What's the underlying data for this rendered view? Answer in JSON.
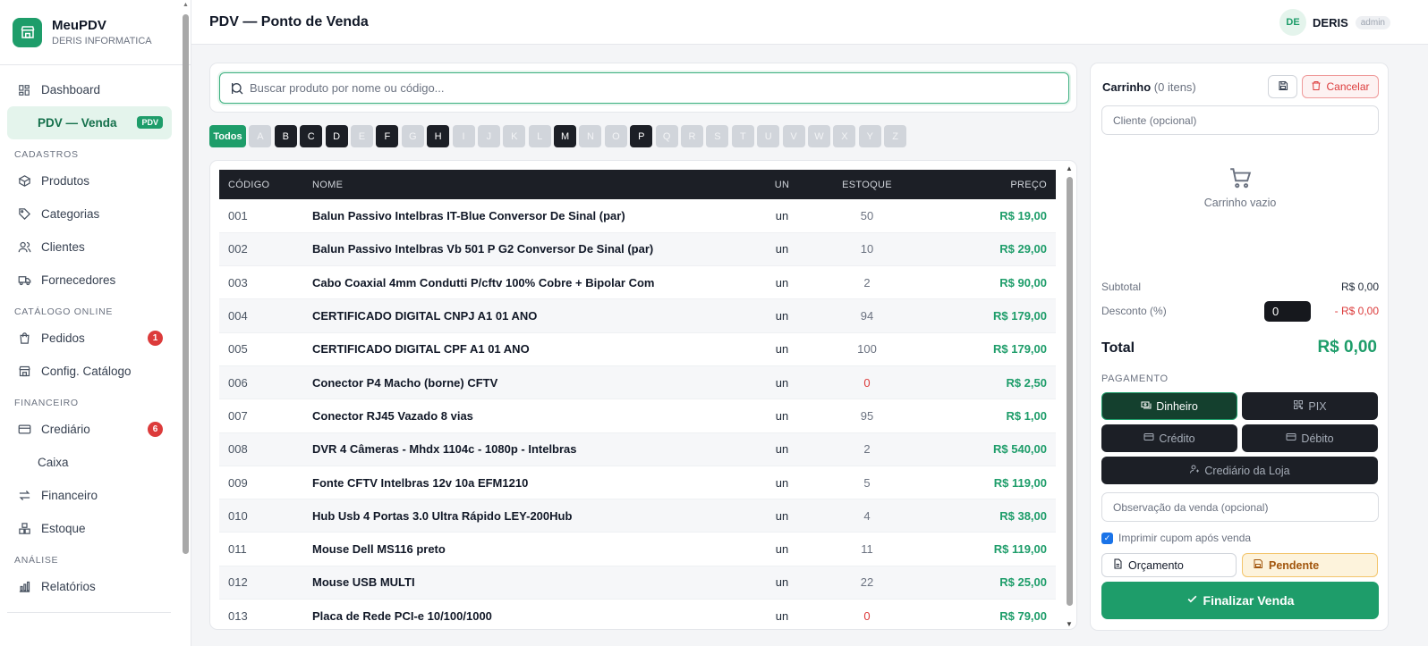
{
  "brand": {
    "name": "MeuPDV",
    "subtitle": "DERIS INFORMATICA",
    "logo_icon": "store-icon"
  },
  "nav": {
    "dashboard": "Dashboard",
    "pdv": "PDV — Venda",
    "pdv_badge": "PDV",
    "sec_cadastros": "CADASTROS",
    "produtos": "Produtos",
    "categorias": "Categorias",
    "clientes": "Clientes",
    "fornecedores": "Fornecedores",
    "sec_catalogo": "CATÁLOGO ONLINE",
    "pedidos": "Pedidos",
    "pedidos_count": "1",
    "config_catalogo": "Config. Catálogo",
    "sec_financeiro": "FINANCEIRO",
    "crediario": "Crediário",
    "crediario_count": "6",
    "caixa": "Caixa",
    "financeiro": "Financeiro",
    "estoque": "Estoque",
    "sec_analise": "ANÁLISE",
    "relatorios": "Relatórios"
  },
  "header": {
    "title": "PDV — Ponto de Venda",
    "user_initials": "DE",
    "user_name": "DERIS",
    "user_role": "admin"
  },
  "search": {
    "placeholder": "Buscar produto por nome ou código..."
  },
  "letter_filter": {
    "all_label": "Todos",
    "letters": [
      {
        "l": "A",
        "on": false
      },
      {
        "l": "B",
        "on": true
      },
      {
        "l": "C",
        "on": true
      },
      {
        "l": "D",
        "on": true
      },
      {
        "l": "E",
        "on": false
      },
      {
        "l": "F",
        "on": true
      },
      {
        "l": "G",
        "on": false
      },
      {
        "l": "H",
        "on": true
      },
      {
        "l": "I",
        "on": false
      },
      {
        "l": "J",
        "on": false
      },
      {
        "l": "K",
        "on": false
      },
      {
        "l": "L",
        "on": false
      },
      {
        "l": "M",
        "on": true
      },
      {
        "l": "N",
        "on": false
      },
      {
        "l": "O",
        "on": false
      },
      {
        "l": "P",
        "on": true
      },
      {
        "l": "Q",
        "on": false
      },
      {
        "l": "R",
        "on": false
      },
      {
        "l": "S",
        "on": false
      },
      {
        "l": "T",
        "on": false
      },
      {
        "l": "U",
        "on": false
      },
      {
        "l": "V",
        "on": false
      },
      {
        "l": "W",
        "on": false
      },
      {
        "l": "X",
        "on": false
      },
      {
        "l": "Y",
        "on": false
      },
      {
        "l": "Z",
        "on": false
      }
    ]
  },
  "table": {
    "headers": {
      "code": "CÓDIGO",
      "name": "NOME",
      "un": "UN",
      "stock": "ESTOQUE",
      "price": "PREÇO"
    },
    "rows": [
      {
        "code": "001",
        "name": "Balun Passivo Intelbras IT-Blue Conversor De Sinal (par)",
        "un": "un",
        "stock": "50",
        "price": "R$ 19,00"
      },
      {
        "code": "002",
        "name": "Balun Passivo Intelbras Vb 501 P G2 Conversor De Sinal (par)",
        "un": "un",
        "stock": "10",
        "price": "R$ 29,00"
      },
      {
        "code": "003",
        "name": "Cabo Coaxial 4mm Condutti P/cftv 100% Cobre + Bipolar Com",
        "un": "un",
        "stock": "2",
        "price": "R$ 90,00"
      },
      {
        "code": "004",
        "name": "CERTIFICADO DIGITAL CNPJ A1 01 ANO",
        "un": "un",
        "stock": "94",
        "price": "R$ 179,00"
      },
      {
        "code": "005",
        "name": "CERTIFICADO DIGITAL CPF A1 01 ANO",
        "un": "un",
        "stock": "100",
        "price": "R$ 179,00"
      },
      {
        "code": "006",
        "name": "Conector P4 Macho (borne) CFTV",
        "un": "un",
        "stock": "0",
        "price": "R$ 2,50"
      },
      {
        "code": "007",
        "name": "Conector RJ45 Vazado 8 vias",
        "un": "un",
        "stock": "95",
        "price": "R$ 1,00"
      },
      {
        "code": "008",
        "name": "DVR 4 Câmeras - Mhdx 1104c - 1080p - Intelbras",
        "un": "un",
        "stock": "2",
        "price": "R$ 540,00"
      },
      {
        "code": "009",
        "name": "Fonte CFTV Intelbras 12v 10a EFM1210",
        "un": "un",
        "stock": "5",
        "price": "R$ 119,00"
      },
      {
        "code": "010",
        "name": "Hub Usb 4 Portas 3.0 Ultra Rápido LEY-200Hub",
        "un": "un",
        "stock": "4",
        "price": "R$ 38,00"
      },
      {
        "code": "011",
        "name": "Mouse Dell MS116 preto",
        "un": "un",
        "stock": "11",
        "price": "R$ 119,00"
      },
      {
        "code": "012",
        "name": "Mouse USB MULTI",
        "un": "un",
        "stock": "22",
        "price": "R$ 25,00"
      },
      {
        "code": "013",
        "name": "Placa de Rede PCI-e 10/100/1000",
        "un": "un",
        "stock": "0",
        "price": "R$ 79,00"
      }
    ]
  },
  "cart": {
    "title": "Carrinho",
    "count_text": "(0 itens)",
    "cancel_label": "Cancelar",
    "client_placeholder": "Cliente (opcional)",
    "empty_text": "Carrinho vazio",
    "subtotal_label": "Subtotal",
    "subtotal_value": "R$ 0,00",
    "discount_label": "Desconto (%)",
    "discount_input": "0",
    "discount_value": "- R$ 0,00",
    "total_label": "Total",
    "total_value": "R$ 0,00",
    "payment_label": "PAGAMENTO",
    "pay_dinheiro": "Dinheiro",
    "pay_pix": "PIX",
    "pay_credito": "Crédito",
    "pay_debito": "Débito",
    "pay_crediario": "Crediário da Loja",
    "obs_placeholder": "Observação da venda (opcional)",
    "print_label": "Imprimir cupom após venda",
    "orcamento_label": "Orçamento",
    "pendente_label": "Pendente",
    "finalize_label": "Finalizar Venda"
  },
  "colors": {
    "accent": "#1e9d6a",
    "dark": "#1c1f26",
    "danger": "#dc3b3b"
  }
}
